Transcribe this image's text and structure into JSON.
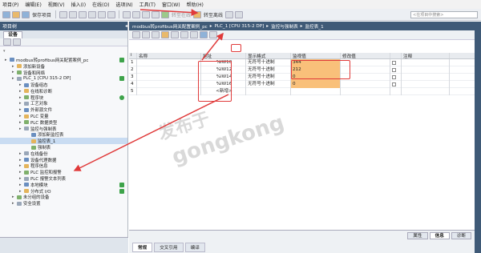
{
  "menu": [
    "项目(P)",
    "编辑(E)",
    "视图(V)",
    "插入(I)",
    "在线(O)",
    "选项(N)",
    "工具(T)",
    "窗口(W)",
    "帮助(H)"
  ],
  "toolbar": {
    "save_label": "保存项目",
    "go_online": "转至在线",
    "go_offline": "转至离线",
    "search_placeholder": "<在项目中搜索>"
  },
  "left_panel": {
    "title": "项目树",
    "tab": "设备",
    "tree": [
      {
        "label": "modbus转profibus网关配置案例_pc",
        "indent": 0,
        "status": "check"
      },
      {
        "label": "添加新设备",
        "indent": 1,
        "status": ""
      },
      {
        "label": "设备和网络",
        "indent": 1,
        "status": ""
      },
      {
        "label": "PLC_1 [CPU 315-2 DP]",
        "indent": 1,
        "status": "check"
      },
      {
        "label": "设备组态",
        "indent": 2,
        "status": ""
      },
      {
        "label": "在线和诊断",
        "indent": 2,
        "status": ""
      },
      {
        "label": "程序块",
        "indent": 2,
        "status": "dot"
      },
      {
        "label": "工艺对象",
        "indent": 2,
        "status": ""
      },
      {
        "label": "外部源文件",
        "indent": 2,
        "status": ""
      },
      {
        "label": "PLC 变量",
        "indent": 2,
        "status": ""
      },
      {
        "label": "PLC 数据类型",
        "indent": 2,
        "status": ""
      },
      {
        "label": "监控与强制表",
        "indent": 2,
        "status": ""
      },
      {
        "label": "添加新监控表",
        "indent": 3,
        "status": ""
      },
      {
        "label": "监控表_1",
        "indent": 3,
        "status": "",
        "selected": true
      },
      {
        "label": "强制表",
        "indent": 3,
        "status": ""
      },
      {
        "label": "在线备份",
        "indent": 2,
        "status": ""
      },
      {
        "label": "设备代理数据",
        "indent": 2,
        "status": ""
      },
      {
        "label": "程序信息",
        "indent": 2,
        "status": ""
      },
      {
        "label": "PLC 监控和报警",
        "indent": 2,
        "status": ""
      },
      {
        "label": "PLC 报警文本列表",
        "indent": 2,
        "status": ""
      },
      {
        "label": "本地模块",
        "indent": 2,
        "status": "check"
      },
      {
        "label": "分布式 I/O",
        "indent": 2,
        "status": "check"
      },
      {
        "label": "未分组的设备",
        "indent": 1,
        "status": ""
      },
      {
        "label": "安全设置",
        "indent": 1,
        "status": ""
      }
    ]
  },
  "main": {
    "breadcrumb": [
      "modbus转profibus网关配置案例_pc",
      "PLC_1 [CPU 315-2 DP]",
      "监控与强制表",
      "监控表_1"
    ],
    "columns": [
      "i",
      "名称",
      "地址",
      "显示格式",
      "监视值",
      "修改值",
      "",
      "注释"
    ],
    "rows": [
      {
        "num": "1",
        "name": "",
        "address": "%IW10",
        "format": "无符号十进制",
        "monitor": "344",
        "modify": ""
      },
      {
        "num": "2",
        "name": "",
        "address": "%IW12",
        "format": "无符号十进制",
        "monitor": "212",
        "modify": ""
      },
      {
        "num": "3",
        "name": "",
        "address": "%IW14",
        "format": "无符号十进制",
        "monitor": "0",
        "modify": ""
      },
      {
        "num": "4",
        "name": "",
        "address": "%IW16",
        "format": "无符号十进制",
        "monitor": "0",
        "modify": ""
      },
      {
        "num": "5",
        "name": "",
        "address": "<新增>",
        "format": "",
        "monitor": "",
        "modify": ""
      }
    ]
  },
  "inspector_tabs": [
    "属性",
    "信息",
    "诊断"
  ],
  "bottom_tabs": [
    "常规",
    "交叉引用",
    "编译"
  ],
  "watermark": {
    "line1": "发布于",
    "line2": "gongkong"
  }
}
